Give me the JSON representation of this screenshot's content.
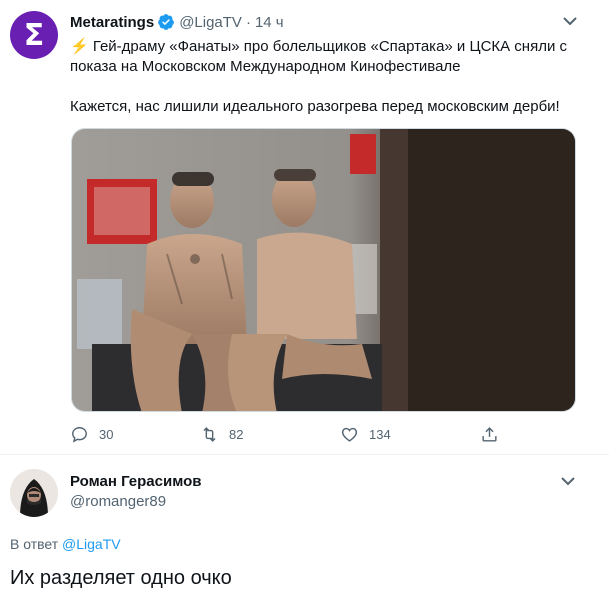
{
  "tweet": {
    "avatar_letter": "Σ",
    "author_name": "Metaratings",
    "handle": "@LigaTV",
    "separator": "·",
    "time": "14 ч",
    "text_line1": "⚡ Гей-драму «Фанаты» про болельщиков «Спартака» и ЦСКА сняли с",
    "text_line2": "показа на Московском Международном Кинофестивале",
    "text_line3": "Кажется, нас лишили идеального разогрева перед московским дерби!",
    "actions": {
      "reply_count": "30",
      "retweet_count": "82",
      "like_count": "134"
    }
  },
  "reply": {
    "author_name": "Роман Герасимов",
    "handle": "@romanger89",
    "reply_to_prefix": "В ответ",
    "reply_to_handle": "@LigaTV",
    "text": "Их разделяет одно очко"
  },
  "colors": {
    "accent": "#1d9bf0",
    "text": "#0f1419",
    "muted": "#536471",
    "avatar_bg": "#6a1fb3"
  },
  "icons": [
    "verified-badge-icon",
    "more-caret-icon",
    "reply-icon",
    "retweet-icon",
    "like-icon",
    "share-icon"
  ]
}
